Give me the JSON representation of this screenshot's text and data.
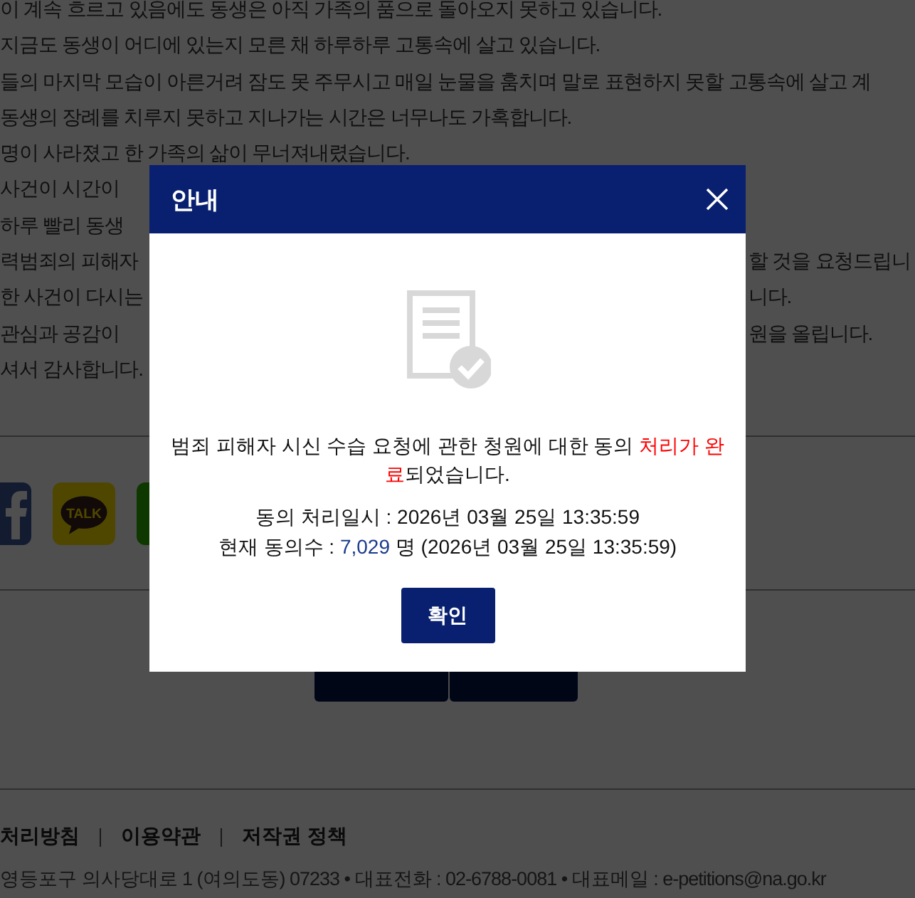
{
  "page": {
    "body_lines": [
      {
        "left": "이 계속 흐르고 있음에도 동생은 아직 가족의 품으로 돌아오지 못하고 있습니다."
      },
      {
        "left": "지금도 동생이 어디에 있는지 모른 채 하루하루 고통속에 살고 있습니다."
      },
      {
        "left": "들의 마지막 모습이 아른거려 잠도 못 주무시고 매일 눈물을 훔치며 말로 표현하지 못할 고통속에 살고 계"
      },
      {
        "left": "동생의 장례를 치루지 못하고 지나가는 시간은 너무나도 가혹합니다."
      },
      {
        "left": "명이 사라졌고 한 가족의 삶이 무너져내렸습니다."
      },
      {
        "left": "사건이 시간이"
      },
      {
        "left": "하루 빨리 동생"
      },
      {
        "left": "력범죄의 피해자",
        "right": "할 것을 요청드립니"
      },
      {
        "left": "한 사건이 다시는",
        "right": "니다."
      },
      {
        "left": "관심과 공감이",
        "right": "원을 올립니다."
      },
      {
        "left": "셔서 감사합니다."
      }
    ],
    "share_talk_label": "TALK",
    "footer": {
      "links": [
        "처리방침",
        "이용약관",
        "저작권 정책"
      ],
      "address": "영등포구 의사당대로 1 (여의도동) 07233 • 대표전화 : 02-6788-0081 • 대표메일 : e-petitions@na.go.kr"
    }
  },
  "dialog": {
    "title": "안내",
    "message": [
      {
        "text": "범죄 피해자 시신 수습 요청에 관한 청원에 대한 동의 ",
        "highlight": false
      },
      {
        "text": "처리가 완료",
        "highlight": true
      },
      {
        "text": "되었습니다.",
        "highlight": false
      }
    ],
    "processed_line": "동의 처리일시 : 2026년 03월 25일 13:35:59",
    "count_label": "현재 동의수 : ",
    "count": "7,029",
    "count_suffix": " 명 (2026년 03월 25일 13:35:59)",
    "confirm_button": "확인"
  }
}
